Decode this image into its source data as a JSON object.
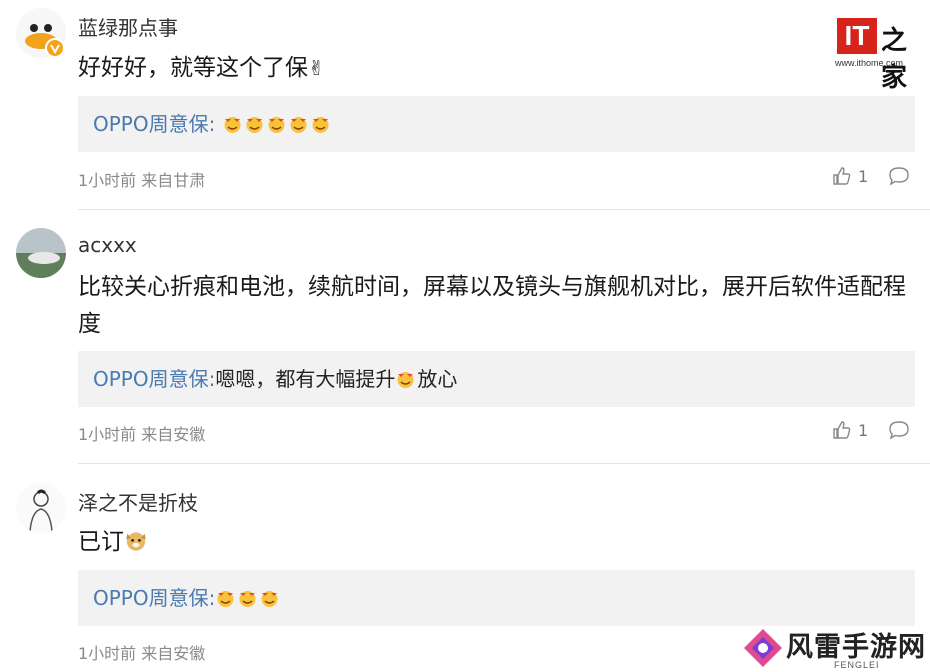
{
  "comments": [
    {
      "username": "蓝绿那点事",
      "text": "好好好，就等这个了保",
      "reply_author": "OPPO周意保:",
      "reply_text": "",
      "meta": "1小时前 来自甘肃",
      "likes": "1"
    },
    {
      "username": "acxxx",
      "text": "比较关心折痕和电池，续航时间，屏幕以及镜头与旗舰机对比，展开后软件适配程度",
      "reply_author": "OPPO周意保:",
      "reply_text_1": "嗯嗯，都有大幅提升",
      "reply_text_2": "放心",
      "meta": "1小时前 来自安徽",
      "likes": "1"
    },
    {
      "username": "泽之不是折枝",
      "text": "已订",
      "reply_author": "OPPO周意保:",
      "reply_text": "",
      "meta": "1小时前 来自安徽"
    }
  ],
  "logo": {
    "mark": "IT",
    "name": "之家",
    "url": "www.ithome.com"
  },
  "watermark": {
    "name": "风雷手游网",
    "sub": "FENGLEI"
  },
  "colors": {
    "reply_author": "#4a7ab0",
    "reply_bg": "#f2f2f2",
    "meta": "#8a8a8a",
    "brand_red": "#d7241a"
  }
}
